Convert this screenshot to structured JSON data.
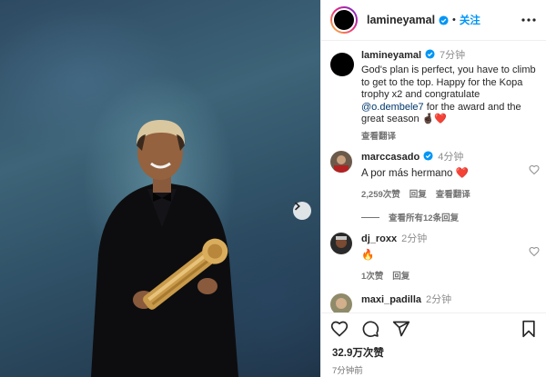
{
  "post": {
    "username": "lamineyamal",
    "follow_label": "关注",
    "dot": "•"
  },
  "caption": {
    "username": "lamineyamal",
    "time": "7分钟",
    "text_before": "God's plan is perfect, you have to climb to get to the top. Happy for the Kopa trophy x2 and congratulate ",
    "mention": "@o.dembele7",
    "text_after": " for the award and the great season 🤞🏿❤️",
    "translate_label": "查看翻译"
  },
  "comments": [
    {
      "username": "marccasado",
      "time": "4分钟",
      "text": "A por más hermano ❤️",
      "likes": "2,259次赞",
      "reply_label": "回复",
      "translate_label": "查看翻译"
    },
    {
      "username": "dj_roxx",
      "time": "2分钟",
      "text": "🔥",
      "likes": "1次赞",
      "reply_label": "回复"
    },
    {
      "username": "maxi_padilla",
      "time": "2分钟"
    }
  ],
  "view_replies": "查看所有12条回复",
  "footer": {
    "likes": "32.9万次赞",
    "posted_ago": "7分钟前"
  },
  "icons": {
    "verified": "verified-badge-icon",
    "more": "more-options-icon",
    "like": "heart-icon",
    "comment": "comment-icon",
    "share": "share-icon",
    "save": "bookmark-icon",
    "next": "chevron-right-icon"
  },
  "colors": {
    "accent": "#0095f6",
    "verified": "#0095f6",
    "muted": "#737373",
    "text": "#262626",
    "mention": "#00376b"
  }
}
